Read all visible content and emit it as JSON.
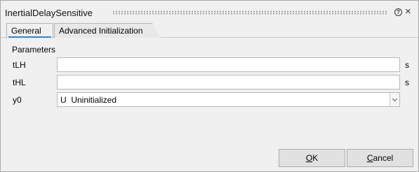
{
  "window": {
    "title": "InertialDelaySensitive"
  },
  "titlebar": {
    "help_icon": "help-circle-icon",
    "close_icon": "close-icon",
    "help_glyph": "?",
    "close_glyph": "×"
  },
  "tabs": [
    {
      "label": "General",
      "active": true
    },
    {
      "label": "Advanced Initialization",
      "active": false
    }
  ],
  "section": {
    "label": "Parameters"
  },
  "params": [
    {
      "name": "tLH",
      "value": "",
      "unit": "s"
    },
    {
      "name": "tHL",
      "value": "",
      "unit": "s"
    }
  ],
  "y0": {
    "name": "y0",
    "selected": "U  Uninitialized"
  },
  "buttons": {
    "ok_mnemonic": "O",
    "ok_rest": "K",
    "cancel_mnemonic": "C",
    "cancel_rest": "ancel"
  },
  "colors": {
    "accent": "#2f86c9",
    "background": "#f0f0f0"
  }
}
